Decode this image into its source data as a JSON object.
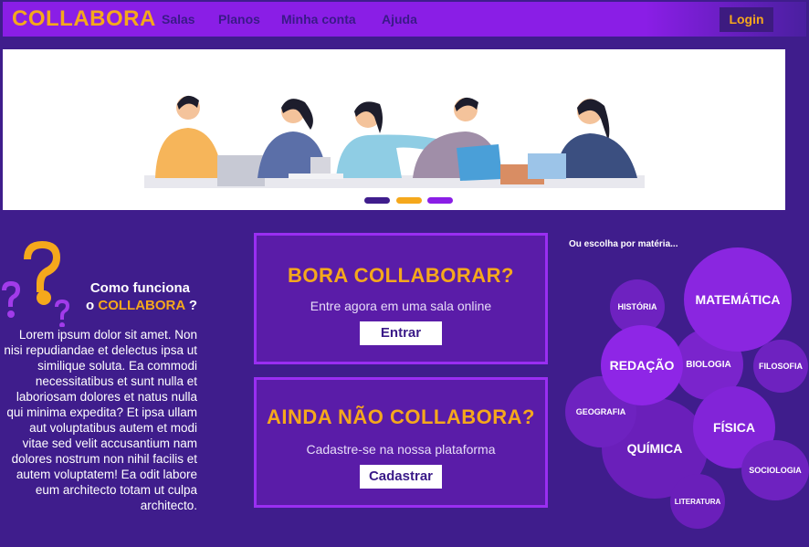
{
  "nav": {
    "brand": "COLLABORA",
    "links": [
      "Salas",
      "Planos",
      "Minha conta",
      "Ajuda"
    ],
    "login": "Login"
  },
  "how": {
    "title_line1": "Como funciona",
    "title_prefix": "o",
    "title_brand": "COLLABORA",
    "title_suffix": "?",
    "text": "Lorem ipsum dolor sit amet. Non nisi repudiandae et delectus ipsa ut similique soluta. Ea commodi necessitatibus et sunt nulla et laboriosam dolores et natus nulla qui minima expedita? Et ipsa ullam aut voluptatibus autem et modi vitae sed velit accusantium nam dolores nostrum non nihil facilis et autem voluptatem! Ea odit labore eum architecto totam ut culpa architecto."
  },
  "cta1": {
    "title": "BORA COLLABORAR?",
    "subtitle": "Entre agora em uma sala online",
    "button": "Entrar"
  },
  "cta2": {
    "title": "AINDA NÃO COLLABORA?",
    "subtitle": "Cadastre-se na nossa plataforma",
    "button": "Cadastrar"
  },
  "subjects": {
    "label": "Ou escolha por matéria...",
    "items": [
      "MATEMÁTICA",
      "HISTÓRIA",
      "REDAÇÃO",
      "BIOLOGIA",
      "FILOSOFIA",
      "GEOGRAFIA",
      "FÍSICA",
      "QUÍMICA",
      "SOCIOLOGIA",
      "LITERATURA"
    ]
  },
  "colors": {
    "background": "#3f1d8c",
    "navbar": "#8a1ee6",
    "accent": "#f5a81c",
    "bubble": "#8a22e0"
  }
}
